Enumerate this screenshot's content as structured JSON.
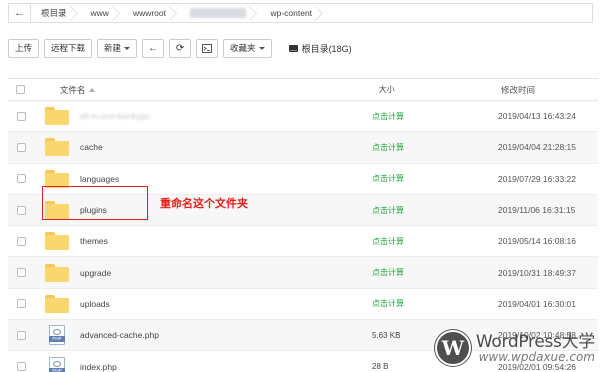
{
  "breadcrumb": {
    "items": [
      "根目录",
      "www",
      "wwwroot",
      "wpdaxue.com",
      "wp-content"
    ]
  },
  "toolbar": {
    "upload": "上传",
    "remote_download": "远程下载",
    "new": "新建",
    "back_icon": "arrow-left-icon",
    "refresh_icon": "refresh-icon",
    "terminal_icon": "terminal-icon",
    "favorites": "收藏夹",
    "disk_label": "根目录(18G)"
  },
  "table": {
    "headers": {
      "name": "文件名",
      "size": "大小",
      "modified": "修改时间"
    },
    "rows": [
      {
        "type": "folder",
        "name": "all-in-one-backups",
        "size": "点击计算",
        "date": "2019/04/13 16:43:24",
        "blurred": true
      },
      {
        "type": "folder",
        "name": "cache",
        "size": "点击计算",
        "date": "2019/04/04 21:28:15"
      },
      {
        "type": "folder",
        "name": "languages",
        "size": "点击计算",
        "date": "2019/07/29 16:33:22"
      },
      {
        "type": "folder",
        "name": "plugins",
        "size": "点击计算",
        "date": "2019/11/06 16:31:15"
      },
      {
        "type": "folder",
        "name": "themes",
        "size": "点击计算",
        "date": "2019/05/14 16:08:16"
      },
      {
        "type": "folder",
        "name": "upgrade",
        "size": "点击计算",
        "date": "2019/10/31 18:49:37"
      },
      {
        "type": "folder",
        "name": "uploads",
        "size": "点击计算",
        "date": "2019/04/01 16:30:01"
      },
      {
        "type": "file",
        "name": "advanced-cache.php",
        "size": "5.63 KB",
        "date": "2019/10/02 10:48:58"
      },
      {
        "type": "file",
        "name": "index.php",
        "size": "28 B",
        "date": "2019/02/01 09:54:26"
      }
    ]
  },
  "annotation": {
    "text": "重命名这个文件夹"
  },
  "watermark": {
    "title": "WordPress大学",
    "url": "www.wpdaxue.com",
    "logo_letter": "W"
  },
  "colors": {
    "accent_green": "#20a53a",
    "annotation_red": "#e5201a",
    "folder_yellow": "#f9d66f"
  }
}
